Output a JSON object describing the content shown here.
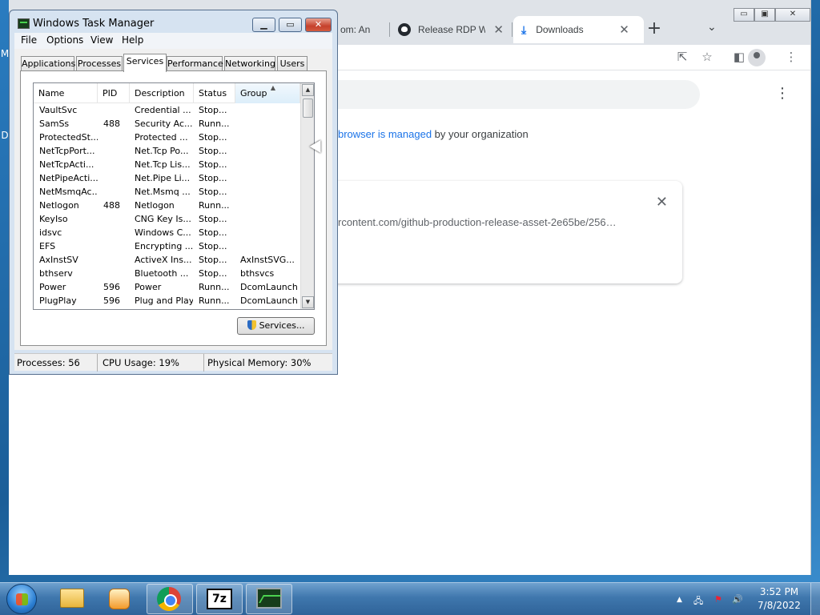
{
  "desktop": {
    "stub_labels": [
      "M",
      "D"
    ]
  },
  "chrome": {
    "tabs": [
      {
        "label": "om: An"
      },
      {
        "label": "Release RDP Wra"
      },
      {
        "label": "Downloads"
      }
    ],
    "tab_close": "✕",
    "new_tab": "+",
    "tab_search": "⌄",
    "window_controls": [
      "▭",
      "▣",
      "✕"
    ],
    "toolbar_icons": [
      "share-icon",
      "star-icon",
      "side-panel-icon",
      "profile-icon",
      "menu-icon"
    ],
    "toolbar_glyphs": {
      "share": "⇱",
      "star": "☆",
      "sidepanel": "◧",
      "menu": "⋮"
    },
    "page": {
      "managed_link": "browser is managed",
      "managed_rest": " by your organization",
      "download_url": "rcontent.com/github-production-release-asset-2e65be/256…",
      "download_close": "✕",
      "kebab": "⋮"
    }
  },
  "taskmgr": {
    "title": "Windows Task Manager",
    "buttons": {
      "minimize": "▁",
      "maximize": "▭",
      "close": "✕"
    },
    "menu": [
      "File",
      "Options",
      "View",
      "Help"
    ],
    "tabs": [
      "Applications",
      "Processes",
      "Services",
      "Performance",
      "Networking",
      "Users"
    ],
    "active_tab": "Services",
    "columns": [
      "Name",
      "PID",
      "Description",
      "Status",
      "Group"
    ],
    "sorted_column": "Group",
    "rows": [
      {
        "name": "VaultSvc",
        "pid": "",
        "desc": "Credential ...",
        "status": "Stop...",
        "group": ""
      },
      {
        "name": "SamSs",
        "pid": "488",
        "desc": "Security Ac...",
        "status": "Runn...",
        "group": ""
      },
      {
        "name": "ProtectedSt...",
        "pid": "",
        "desc": "Protected ...",
        "status": "Stop...",
        "group": ""
      },
      {
        "name": "NetTcpPort...",
        "pid": "",
        "desc": "Net.Tcp Po...",
        "status": "Stop...",
        "group": ""
      },
      {
        "name": "NetTcpActi...",
        "pid": "",
        "desc": "Net.Tcp Lis...",
        "status": "Stop...",
        "group": ""
      },
      {
        "name": "NetPipeActi...",
        "pid": "",
        "desc": "Net.Pipe Li...",
        "status": "Stop...",
        "group": ""
      },
      {
        "name": "NetMsmqAc...",
        "pid": "",
        "desc": "Net.Msmq ...",
        "status": "Stop...",
        "group": ""
      },
      {
        "name": "Netlogon",
        "pid": "488",
        "desc": "Netlogon",
        "status": "Runn...",
        "group": ""
      },
      {
        "name": "KeyIso",
        "pid": "",
        "desc": "CNG Key Is...",
        "status": "Stop...",
        "group": ""
      },
      {
        "name": "idsvc",
        "pid": "",
        "desc": "Windows C...",
        "status": "Stop...",
        "group": ""
      },
      {
        "name": "EFS",
        "pid": "",
        "desc": "Encrypting ...",
        "status": "Stop...",
        "group": ""
      },
      {
        "name": "AxInstSV",
        "pid": "",
        "desc": "ActiveX Ins...",
        "status": "Stop...",
        "group": "AxInstSVG..."
      },
      {
        "name": "bthserv",
        "pid": "",
        "desc": "Bluetooth ...",
        "status": "Stop...",
        "group": "bthsvcs"
      },
      {
        "name": "Power",
        "pid": "596",
        "desc": "Power",
        "status": "Runn...",
        "group": "DcomLaunch"
      },
      {
        "name": "PlugPlay",
        "pid": "596",
        "desc": "Plug and Play",
        "status": "Runn...",
        "group": "DcomLaunch"
      }
    ],
    "scroll_up": "▲",
    "scroll_down": "▼",
    "services_button": "Services...",
    "status": {
      "processes": "Processes: 56",
      "cpu": "CPU Usage: 19%",
      "memory": "Physical Memory: 30%"
    }
  },
  "taskbar": {
    "apps": [
      "start-button",
      "explorer",
      "media-player",
      "chrome",
      "7-zip",
      "task-manager"
    ],
    "tray_glyphs": {
      "expand": "▲",
      "network": "🖧",
      "flag": "⚑",
      "volume": "🔊"
    },
    "time": "3:52 PM",
    "date": "7/8/2022"
  },
  "colors": {
    "chrome_accent": "#1a73e8",
    "taskbar": "#3f77ad",
    "tm_frame": "#d6e3f1"
  }
}
